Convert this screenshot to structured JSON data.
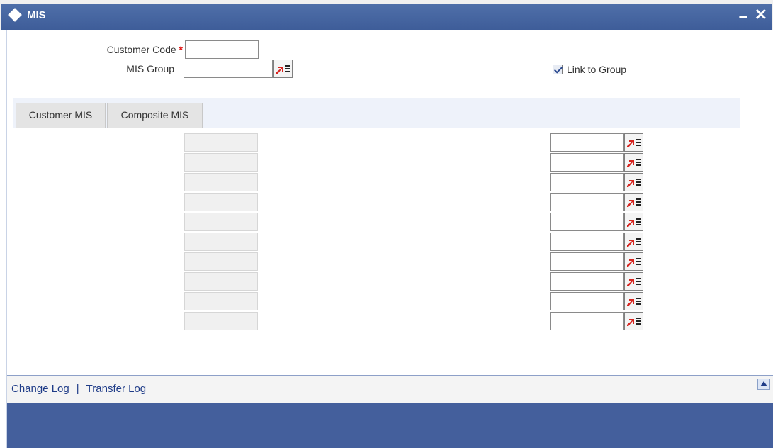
{
  "window": {
    "title": "MIS",
    "minimize_glyph": "–",
    "close_glyph": "✕"
  },
  "form": {
    "customer_code_label": "Customer Code",
    "required_marker": "*",
    "customer_code_value": "",
    "mis_group_label": "MIS Group",
    "mis_group_value": "",
    "link_to_group_label": "Link to Group",
    "link_to_group_checked": true
  },
  "tabs": [
    {
      "label": "Customer MIS"
    },
    {
      "label": "Composite MIS"
    }
  ],
  "mis_rows": [
    {
      "class": "",
      "value": ""
    },
    {
      "class": "",
      "value": ""
    },
    {
      "class": "",
      "value": ""
    },
    {
      "class": "",
      "value": ""
    },
    {
      "class": "",
      "value": ""
    },
    {
      "class": "",
      "value": ""
    },
    {
      "class": "",
      "value": ""
    },
    {
      "class": "",
      "value": ""
    },
    {
      "class": "",
      "value": ""
    },
    {
      "class": "",
      "value": ""
    }
  ],
  "footer": {
    "change_log": "Change Log",
    "separator": "|",
    "transfer_log": "Transfer Log"
  },
  "icons": {
    "lov": "list-of-values-icon",
    "scroll_up": "scroll-up-arrow-icon"
  },
  "colors": {
    "titlebar": "#4a68a3",
    "bottom_band": "#445f9c",
    "link": "#1f3c88",
    "required": "#e01010"
  }
}
